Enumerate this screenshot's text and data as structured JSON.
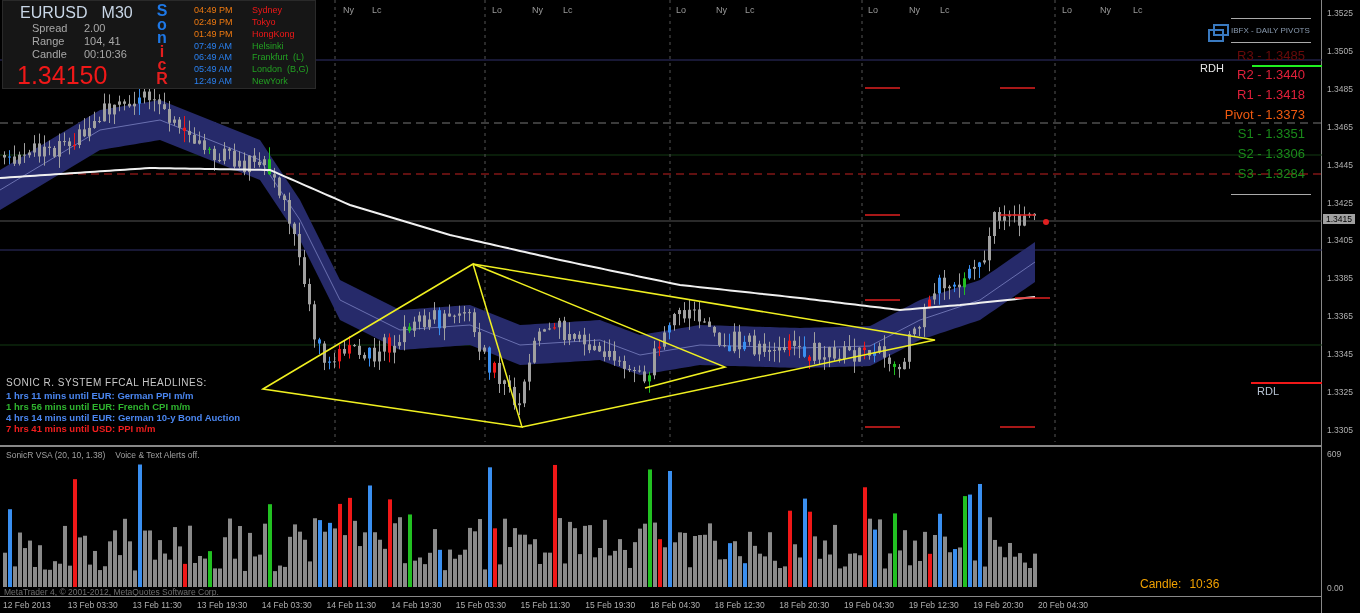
{
  "symbol_panel": {
    "symbol": "EURUSD",
    "timeframe": "M30",
    "rows": [
      {
        "label": "Spread",
        "value": "2.00"
      },
      {
        "label": "Range",
        "value": "104, 41"
      },
      {
        "label": "Candle",
        "value": "00:10:36"
      }
    ],
    "price": "1.34150",
    "brand_letters": [
      {
        "char": "S",
        "color": "#1e78e6"
      },
      {
        "char": "o",
        "color": "#1e78e6"
      },
      {
        "char": "n",
        "color": "#1e78e6"
      },
      {
        "char": "i",
        "color": "#e61e1e"
      },
      {
        "char": "c",
        "color": "#e61e1e"
      },
      {
        "char": "R",
        "color": "#e61e1e"
      }
    ]
  },
  "market_clocks": [
    {
      "time": "04:49 PM",
      "city": "Sydney",
      "kind": "closed"
    },
    {
      "time": "02:49 PM",
      "city": "Tokyo",
      "kind": "closed"
    },
    {
      "time": "01:49 PM",
      "city": "HongKong",
      "kind": "closed"
    },
    {
      "time": "07:49 AM",
      "city": "Helsinki",
      "kind": "open"
    },
    {
      "time": "06:49 AM",
      "city": "Frankfurt  (L)",
      "kind": "open"
    },
    {
      "time": "05:49 AM",
      "city": "London  (B,G)",
      "kind": "open"
    },
    {
      "time": "12:49 AM",
      "city": "NewYork",
      "kind": "open"
    }
  ],
  "session_markers": [
    {
      "label": "Ny"
    },
    {
      "label": "Lc"
    },
    {
      "label": "Lo"
    },
    {
      "label": "Ny"
    },
    {
      "label": "Lc"
    },
    {
      "label": "Lo"
    },
    {
      "label": "Ny"
    },
    {
      "label": "Lc"
    },
    {
      "label": "Lo"
    },
    {
      "label": "Ny"
    },
    {
      "label": "Lc"
    },
    {
      "label": "Lo"
    },
    {
      "label": "Ny"
    },
    {
      "label": "Lc"
    }
  ],
  "pivots": {
    "title": "IBFX - DAILY PIVOTS",
    "levels": [
      {
        "label": "R3 - 1.3485",
        "kind": "r3"
      },
      {
        "label": "R2 - 1.3440",
        "kind": "r2"
      },
      {
        "label": "R1 - 1.3418",
        "kind": "r1"
      },
      {
        "label": "Pivot - 1.3373",
        "kind": "pivot"
      },
      {
        "label": "S1 - 1.3351",
        "kind": "s"
      },
      {
        "label": "S2 - 1.3306",
        "kind": "s"
      },
      {
        "label": "S3 - 1.3284",
        "kind": "s"
      }
    ]
  },
  "range_labels": {
    "high": "RDH",
    "low": "RDL"
  },
  "headlines": {
    "title": "SONIC R. SYSTEM  FFCAL HEADLINES:",
    "items": [
      {
        "text": "1 hrs 11 mins until EUR: German PPI m/m",
        "color": "#4a86f0"
      },
      {
        "text": "1 hrs 56 mins until EUR: French CPI m/m",
        "color": "#2fb52f"
      },
      {
        "text": "4 hrs 14 mins until EUR: German 10-y Bond Auction",
        "color": "#4a86f0"
      },
      {
        "text": "7 hrs 41 mins until USD: PPI m/m",
        "color": "#f01e1e"
      }
    ]
  },
  "volume_pane": {
    "title": "SonicR VSA  (20, 10, 1.38)",
    "alert": "Voice & Text Alerts off.",
    "axis_max": "609",
    "axis_min": "0.00"
  },
  "candle_timer": {
    "label": "Candle:",
    "value": "10:36"
  },
  "copyright": "MetaTrader 4, © 2001-2012, MetaQuotes Software Corp.",
  "price_axis": {
    "ticks": [
      "1.3525",
      "1.3505",
      "1.3485",
      "1.3465",
      "1.3445",
      "1.3425",
      "1.3405",
      "1.3385",
      "1.3365",
      "1.3345",
      "1.3325",
      "1.3305"
    ],
    "current": "1.3415"
  },
  "time_axis": [
    "12 Feb 2013",
    "13 Feb 03:30",
    "13 Feb 11:30",
    "13 Feb 19:30",
    "14 Feb 03:30",
    "14 Feb 11:30",
    "14 Feb 19:30",
    "15 Feb 03:30",
    "15 Feb 11:30",
    "15 Feb 19:30",
    "18 Feb 04:30",
    "18 Feb 12:30",
    "18 Feb 20:30",
    "19 Feb 04:30",
    "19 Feb 12:30",
    "19 Feb 20:30",
    "20 Feb 04:30"
  ]
}
